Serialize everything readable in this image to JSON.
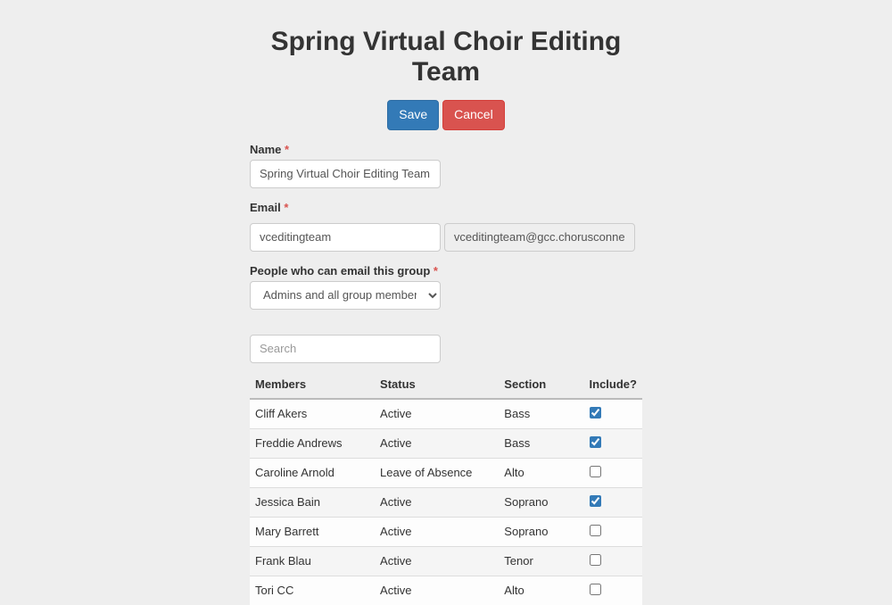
{
  "page": {
    "title": "Spring Virtual Choir Editing Team"
  },
  "buttons": {
    "save": "Save",
    "cancel": "Cancel"
  },
  "form": {
    "name_label": "Name",
    "name_value": "Spring Virtual Choir Editing Team",
    "email_label": "Email",
    "email_value": "vceditingteam",
    "email_full": "vceditingteam@gcc.chorusconnectionde",
    "permissions_label": "People who can email this group",
    "permissions_value": "Admins and all group members",
    "search_placeholder": "Search"
  },
  "table": {
    "headers": {
      "members": "Members",
      "status": "Status",
      "section": "Section",
      "include": "Include?"
    },
    "rows": [
      {
        "name": "Cliff Akers",
        "status": "Active",
        "section": "Bass",
        "include": true
      },
      {
        "name": "Freddie Andrews",
        "status": "Active",
        "section": "Bass",
        "include": true
      },
      {
        "name": "Caroline Arnold",
        "status": "Leave of Absence",
        "section": "Alto",
        "include": false
      },
      {
        "name": "Jessica Bain",
        "status": "Active",
        "section": "Soprano",
        "include": true
      },
      {
        "name": "Mary Barrett",
        "status": "Active",
        "section": "Soprano",
        "include": false
      },
      {
        "name": "Frank Blau",
        "status": "Active",
        "section": "Tenor",
        "include": false
      },
      {
        "name": "Tori CC",
        "status": "Active",
        "section": "Alto",
        "include": false
      }
    ]
  }
}
